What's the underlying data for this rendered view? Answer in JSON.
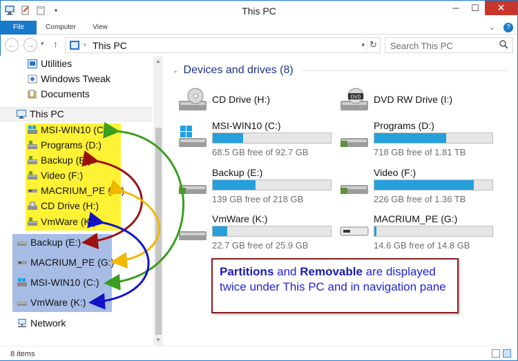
{
  "window": {
    "title": "This PC"
  },
  "ribbon": {
    "tabs": [
      "File",
      "Computer",
      "View"
    ],
    "accent": "#1979ca"
  },
  "address": {
    "crumb": "This PC",
    "search_placeholder": "Search This PC"
  },
  "nav": {
    "top_items": [
      {
        "label": "Utilities",
        "icon": "utilities-icon"
      },
      {
        "label": "Windows Tweak",
        "icon": "windows-tweak-icon"
      },
      {
        "label": "Documents",
        "icon": "documents-icon"
      }
    ],
    "this_pc": "This PC",
    "yellow_items": [
      {
        "label": "MSI-WIN10 (C:)",
        "icon": "windows-drive-icon"
      },
      {
        "label": "Programs (D:)",
        "icon": "drive-icon"
      },
      {
        "label": "Backup (E:)",
        "icon": "drive-icon"
      },
      {
        "label": "Video (F:)",
        "icon": "drive-icon"
      },
      {
        "label": "MACRIUM_PE (G:)",
        "icon": "removable-drive-icon"
      },
      {
        "label": "CD Drive (H:)",
        "icon": "cd-drive-icon"
      },
      {
        "label": "VmWare (K:)",
        "icon": "drive-icon"
      }
    ],
    "blue_items": [
      {
        "label": "Backup (E:)",
        "icon": "drive-icon"
      },
      {
        "label": "MACRIUM_PE (G:)",
        "icon": "removable-drive-icon"
      },
      {
        "label": "MSI-WIN10 (C:)",
        "icon": "windows-drive-icon"
      },
      {
        "label": "VmWare (K:)",
        "icon": "drive-icon"
      }
    ],
    "network": "Network",
    "highlight_yellow": "#fff234",
    "highlight_blue": "#a7bde6"
  },
  "content": {
    "group_title": "Devices and drives (8)",
    "drives": [
      {
        "name": "CD Drive (H:)",
        "type": "optical"
      },
      {
        "name": "DVD RW Drive (I:)",
        "type": "optical"
      },
      {
        "name": "MSI-WIN10 (C:)",
        "type": "windows",
        "free": "68.5 GB free of 92.7 GB",
        "used_fraction": 0.26
      },
      {
        "name": "Programs (D:)",
        "type": "hdd",
        "free": "718 GB free of 1.81 TB",
        "used_fraction": 0.61
      },
      {
        "name": "Backup (E:)",
        "type": "hdd",
        "free": "139 GB free of 218 GB",
        "used_fraction": 0.36
      },
      {
        "name": "Video (F:)",
        "type": "hdd",
        "free": "226 GB free of 1.36 TB",
        "used_fraction": 0.84
      },
      {
        "name": "VmWare (K:)",
        "type": "hdd",
        "free": "22.7 GB free of 25.9 GB",
        "used_fraction": 0.12
      },
      {
        "name": "MACRIUM_PE (G:)",
        "type": "removable",
        "free": "14.6 GB free of 14.8 GB",
        "used_fraction": 0.02
      }
    ],
    "bar_color": "#26a0da"
  },
  "annotation": {
    "bold1": "Partitions",
    "text1": " and ",
    "bold2": "Removable",
    "text2": " are displayed twice under This PC and in navigation pane"
  },
  "status": {
    "count": "8 items"
  },
  "arrow_colors": {
    "green": "#3a9e1f",
    "darkred": "#9b1111",
    "gold": "#f2b800",
    "navy": "#1212c8"
  }
}
